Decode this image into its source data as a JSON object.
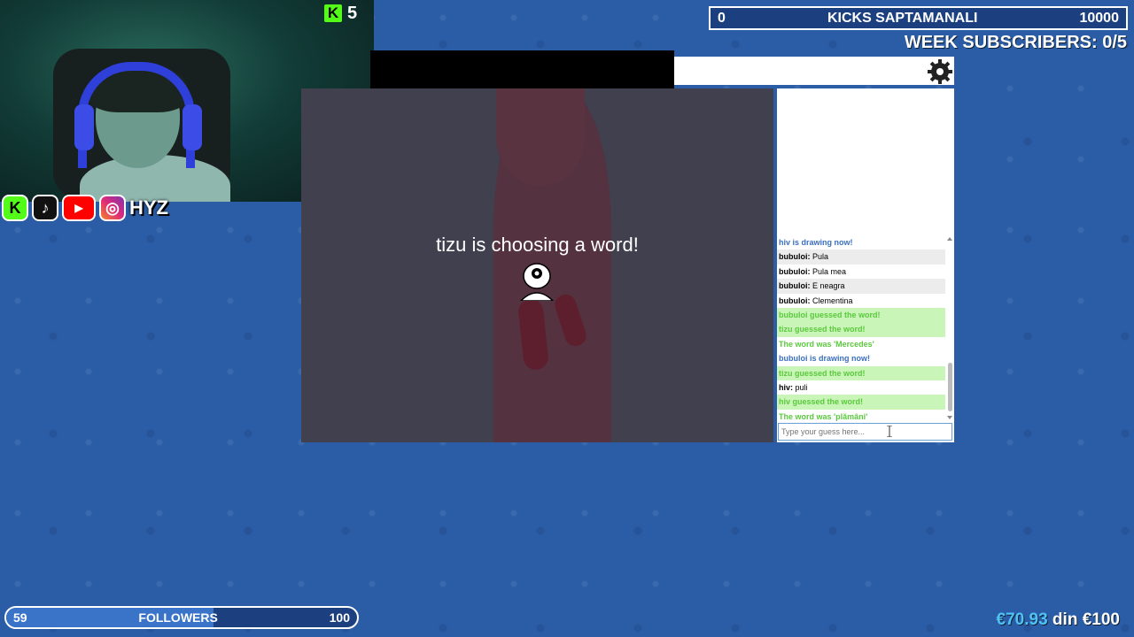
{
  "webcam": {
    "kick_count": "5"
  },
  "socials": {
    "handle": "HYZ"
  },
  "top_right": {
    "kicks_left": "0",
    "kicks_label": "KICKS SAPTAMANALI",
    "kicks_goal": "10000",
    "week_subs": "WEEK SUBSCRIBERS: 0/5"
  },
  "canvas": {
    "status_text": "tizu is choosing a word!"
  },
  "chat": {
    "messages": [
      {
        "type": "blue",
        "user": "",
        "text": "hiv is drawing now!"
      },
      {
        "type": "alt",
        "user": "bubuloi:",
        "text": " Pula"
      },
      {
        "type": "normal",
        "user": "bubuloi:",
        "text": " Pula mea"
      },
      {
        "type": "alt",
        "user": "bubuloi:",
        "text": " E neagra"
      },
      {
        "type": "normal",
        "user": "bubuloi:",
        "text": " Clementina"
      },
      {
        "type": "green",
        "user": "",
        "text": "bubuloi guessed the word!"
      },
      {
        "type": "green",
        "user": "",
        "text": "tizu guessed the word!"
      },
      {
        "type": "green-plain",
        "user": "",
        "text": "The word was 'Mercedes'"
      },
      {
        "type": "blue",
        "user": "",
        "text": "bubuloi is drawing now!"
      },
      {
        "type": "green",
        "user": "",
        "text": "tizu guessed the word!"
      },
      {
        "type": "normal",
        "user": "hiv:",
        "text": " puli"
      },
      {
        "type": "green",
        "user": "",
        "text": "hiv guessed the word!"
      },
      {
        "type": "green-plain",
        "user": "",
        "text": "The word was 'plămâni'"
      }
    ],
    "input_placeholder": "Type your guess here..."
  },
  "followers": {
    "current": "59",
    "label": "FOLLOWERS",
    "goal": "100",
    "progress": 0.59
  },
  "donation": {
    "amount": "€70.93",
    "separator": " din ",
    "goal": "€100"
  },
  "colors": {
    "kick_green": "#53fc18",
    "chat_green": "#5bc93e",
    "chat_blue": "#3a6fbf",
    "donation_blue": "#4fc3f7"
  }
}
